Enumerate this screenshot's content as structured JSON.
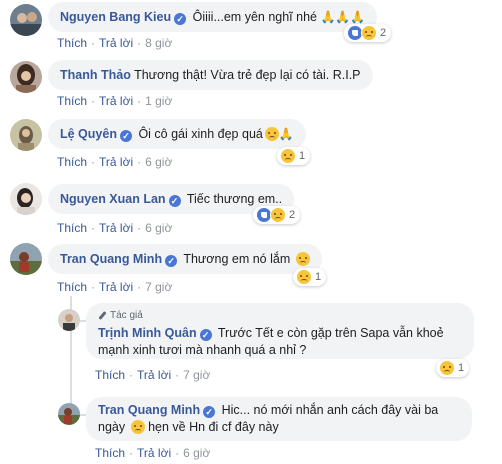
{
  "comments": [
    {
      "author": "Nguyen Bang Kieu",
      "text": "Ôiiii...em yên nghĩ nhé",
      "emoji": "🙏🙏🙏",
      "reactions": {
        "types": [
          "like",
          "sad"
        ],
        "count": "2"
      },
      "actions": {
        "like": "Thích",
        "reply": "Trả lời",
        "time": "8 giờ"
      }
    },
    {
      "author": "Thanh Thảo",
      "text": "Thương thật! Vừa trẻ đẹp lại có tài. R.I.P",
      "actions": {
        "like": "Thích",
        "reply": "Trả lời",
        "time": "1 giờ"
      }
    },
    {
      "author": "Lệ Quyên",
      "text": "Ôi cô gái xinh đẹp quá",
      "emoji": "🙏",
      "reactions": {
        "types": [
          "sad"
        ],
        "count": "1"
      },
      "actions": {
        "like": "Thích",
        "reply": "Trả lời",
        "time": "6 giờ"
      }
    },
    {
      "author": "Nguyen Xuan Lan",
      "text": "Tiếc thương em..",
      "reactions": {
        "types": [
          "like",
          "sad"
        ],
        "count": "2"
      },
      "actions": {
        "like": "Thích",
        "reply": "Trả lời",
        "time": "6 giờ"
      }
    },
    {
      "author": "Tran Quang Minh",
      "text": "Thương em nó lắm",
      "reactions": {
        "types": [
          "sad"
        ],
        "count": "1"
      },
      "actions": {
        "like": "Thích",
        "reply": "Trả lời",
        "time": "7 giờ"
      }
    }
  ],
  "replies": [
    {
      "author_tag": "Tác giả",
      "author": "Trịnh Minh Quân",
      "text": "Trước Tết e còn gặp trên Sapa vẫn khoẻ mạnh xinh tươi mà nhanh quá a nhỉ ?",
      "reactions": {
        "types": [
          "sad"
        ],
        "count": "1"
      },
      "actions": {
        "like": "Thích",
        "reply": "Trả lời",
        "time": "7 giờ"
      }
    },
    {
      "author": "Tran Quang Minh",
      "text": "Hic... nó mới nhắn anh cách đây vài ba ngày",
      "text_after_emoji": "hẹn về Hn đi cf đây này",
      "actions": {
        "like": "Thích",
        "reply": "Trả lời",
        "time": "6 giờ"
      }
    }
  ],
  "colors": {
    "name": "#385898",
    "bubble": "#f2f3f5",
    "meta": "#90949c",
    "verified": "#4a76d6"
  }
}
